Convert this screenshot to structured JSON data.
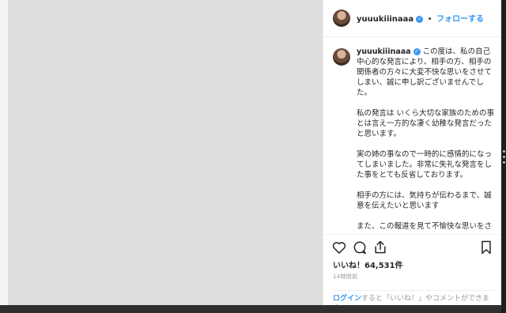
{
  "post": {
    "username": "yuuukiiinaaa",
    "dot": "•",
    "follow_label": "フォローする",
    "caption_paragraphs": [
      "この度は、私の自己中心的な発言により、相手の方、相手の関係者の方々に大変不快な思いをさせてしまい、誠に申し訳ございませんでした。",
      "私の発言は いくら大切な家族のための事とは言え一方的な凄く幼稚な発言だったと思います。",
      "実の姉の事なので一時的に感情的になってしまいました。非常に失礼な発言をした事をとても反省しております。",
      "相手の方には、気持ちが伝わるまで、誠意を伝えたいと思います",
      "また、この報道を見て不愉快な思いをさ"
    ],
    "likes_label": "いいね！64,531件",
    "time_label": "14時間前",
    "login_link": "ログイン",
    "login_rest": "すると「いいね！」やコメントができます。"
  },
  "icons": [
    "verified-badge-icon",
    "heart-icon",
    "comment-icon",
    "share-icon",
    "bookmark-icon"
  ],
  "colors": {
    "accent": "#3897f0",
    "photo_placeholder": "#dedede"
  }
}
